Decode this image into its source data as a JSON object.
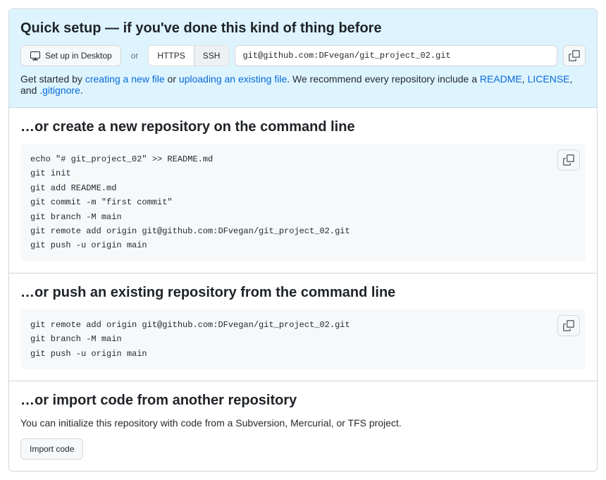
{
  "quick_setup": {
    "heading": "Quick setup — if you've done this kind of thing before",
    "desktop_button": "Set up in Desktop",
    "or": "or",
    "https": "HTTPS",
    "ssh": "SSH",
    "clone_url": "git@github.com:DFvegan/git_project_02.git",
    "help_prefix": "Get started by ",
    "link_create": "creating a new file",
    "help_or": " or ",
    "link_upload": "uploading an existing file",
    "help_mid": ". We recommend every repository include a ",
    "link_readme": "README",
    "comma1": ", ",
    "link_license": "LICENSE",
    "comma2": ", and ",
    "link_gitignore": ".gitignore",
    "period": "."
  },
  "create_repo": {
    "heading": "…or create a new repository on the command line",
    "code": "echo \"# git_project_02\" >> README.md\ngit init\ngit add README.md\ngit commit -m \"first commit\"\ngit branch -M main\ngit remote add origin git@github.com:DFvegan/git_project_02.git\ngit push -u origin main"
  },
  "push_repo": {
    "heading": "…or push an existing repository from the command line",
    "code": "git remote add origin git@github.com:DFvegan/git_project_02.git\ngit branch -M main\ngit push -u origin main"
  },
  "import_repo": {
    "heading": "…or import code from another repository",
    "text": "You can initialize this repository with code from a Subversion, Mercurial, or TFS project.",
    "button": "Import code"
  }
}
